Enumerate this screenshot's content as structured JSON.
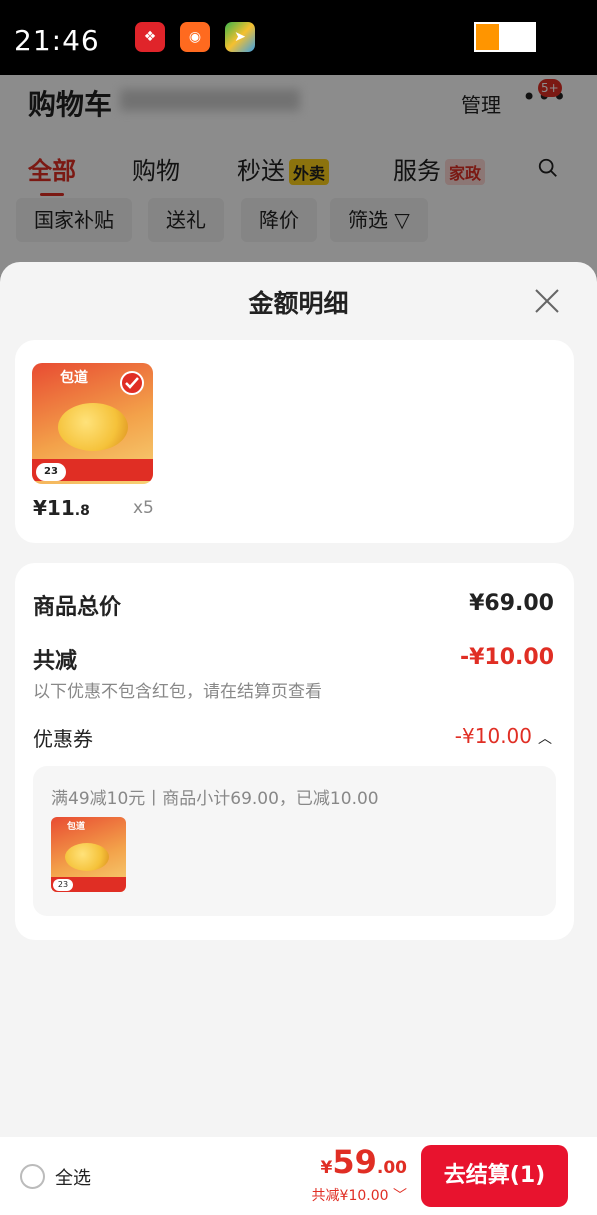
{
  "status_bar": {
    "time": "21:46",
    "apps": [
      "pinduoduo-icon",
      "kuaishou-icon",
      "map-icon"
    ],
    "battery_level": 0.4
  },
  "background_page": {
    "title": "购物车",
    "manage": "管理",
    "more_badge": "5+",
    "tabs": [
      {
        "label": "全部",
        "active": true
      },
      {
        "label": "购物"
      },
      {
        "label": "秒送",
        "tag": "外卖"
      },
      {
        "label": "服务",
        "tag": "家政"
      }
    ],
    "chips": [
      "国家补贴",
      "送礼",
      "降价",
      "筛选"
    ]
  },
  "sheet": {
    "title": "金额明细",
    "item": {
      "thumb_brand": "包道",
      "thumb_badge": "23",
      "price_int": "¥11",
      "price_dec": ".8",
      "quantity": "x5"
    },
    "summary": {
      "goods_total_label": "商品总价",
      "goods_total_value": "¥69.00",
      "discount_label": "共减",
      "discount_value": "-¥10.00",
      "discount_note": "以下优惠不包含红包，请在结算页查看",
      "coupon_label": "优惠券",
      "coupon_value": "-¥10.00",
      "coupon_detail": "满49减10元丨商品小计69.00，已减10.00"
    }
  },
  "bottom_bar": {
    "select_all": "全选",
    "total_yen": "¥",
    "total_int": "59",
    "total_dec": ".00",
    "saved": "共减¥10.00",
    "checkout": "去结算(1)"
  },
  "colors": {
    "accent_red": "#e02e24",
    "checkout_red": "#e8132e",
    "background": "#f4f4f4"
  }
}
